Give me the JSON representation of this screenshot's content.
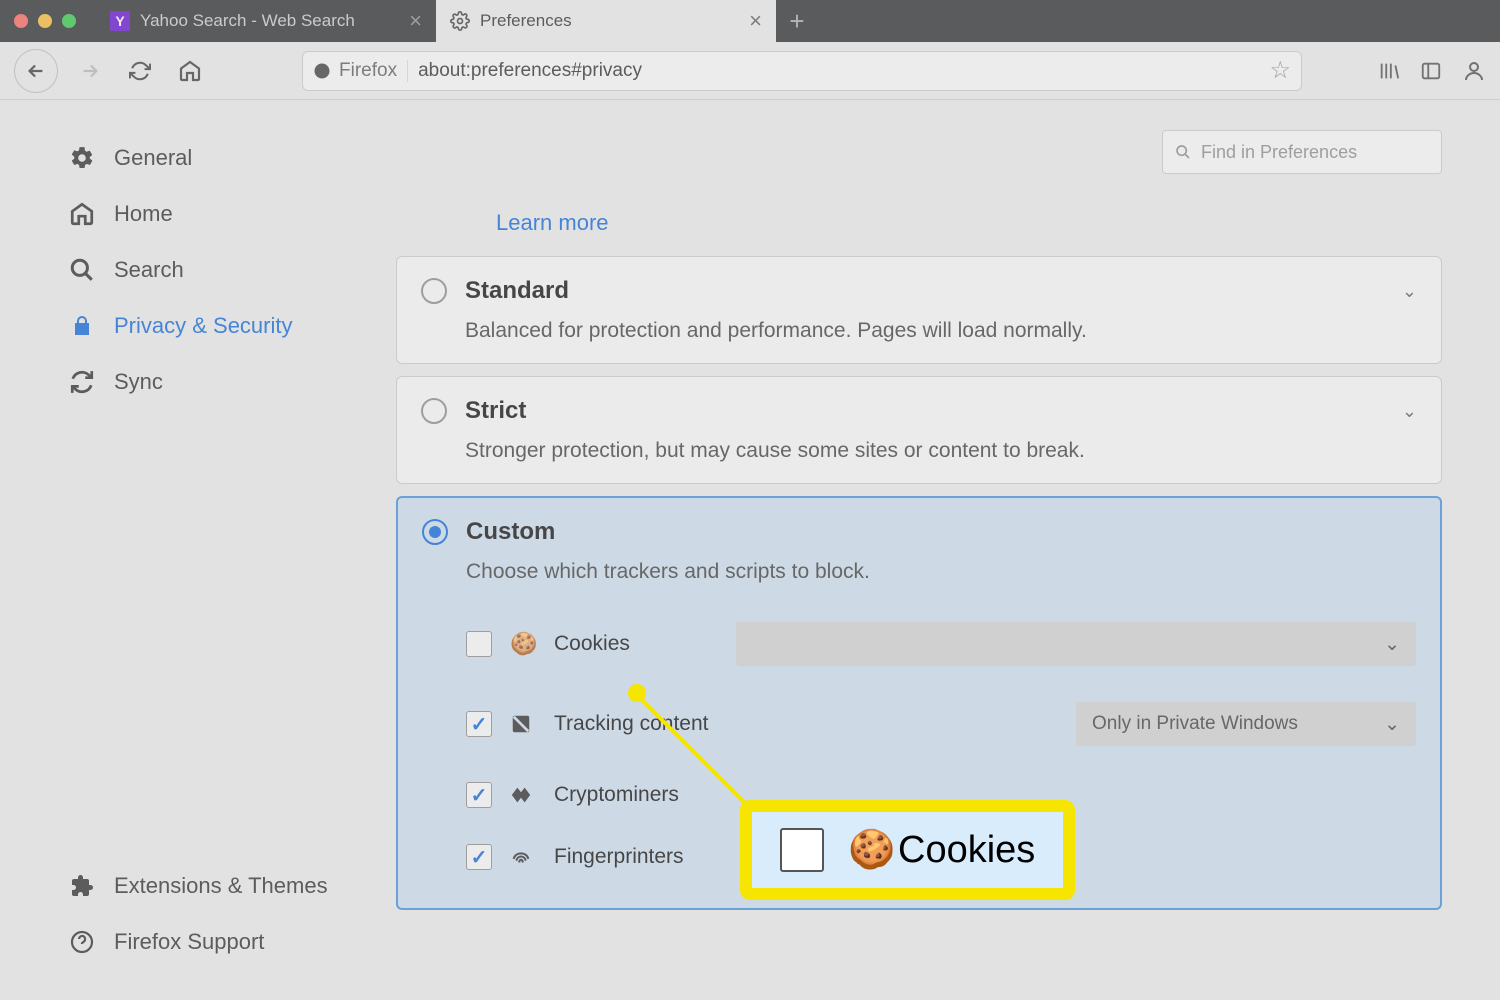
{
  "tabs": {
    "yahoo": "Yahoo Search - Web Search",
    "prefs": "Preferences"
  },
  "url": {
    "identity": "Firefox",
    "address": "about:preferences#privacy"
  },
  "search_prefs_placeholder": "Find in Preferences",
  "sidebar": {
    "general": "General",
    "home": "Home",
    "search": "Search",
    "privacy": "Privacy & Security",
    "sync": "Sync",
    "extensions": "Extensions & Themes",
    "support": "Firefox Support"
  },
  "learn_more": "Learn more",
  "options": {
    "standard": {
      "title": "Standard",
      "desc": "Balanced for protection and performance. Pages will load normally."
    },
    "strict": {
      "title": "Strict",
      "desc": "Stronger protection, but may cause some sites or content to break."
    },
    "custom": {
      "title": "Custom",
      "desc": "Choose which trackers and scripts to block."
    }
  },
  "custom_rows": {
    "cookies": "Cookies",
    "tracking": "Tracking content",
    "tracking_select": "Only in Private Windows",
    "cryptominers": "Cryptominers",
    "fingerprinters": "Fingerprinters"
  },
  "callout_label": "Cookies"
}
